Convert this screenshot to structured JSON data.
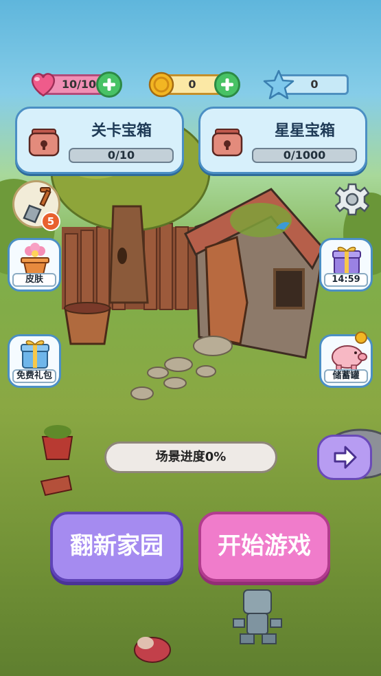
{
  "resources": {
    "lives": "10/10",
    "coins": "0",
    "stars": "0"
  },
  "chests": [
    {
      "title": "关卡宝箱",
      "progress": "0/10"
    },
    {
      "title": "星星宝箱",
      "progress": "0/1000"
    }
  ],
  "shovel": {
    "count": "5"
  },
  "left_buttons": {
    "skin": "皮肤",
    "free_gift": "免费礼包"
  },
  "right_buttons": {
    "timer": "14:59",
    "piggy_bank": "储蓄罐"
  },
  "scene_progress": "场景进度0%",
  "buttons": {
    "renovate": "翻新家园",
    "start": "开始游戏"
  },
  "colors": {
    "heart": "#ef5b8b",
    "coin": "#f2b623",
    "star": "#7ec8ec",
    "plus": "#48c265",
    "renovate": "#9b7fe8",
    "start": "#ef74c9"
  }
}
